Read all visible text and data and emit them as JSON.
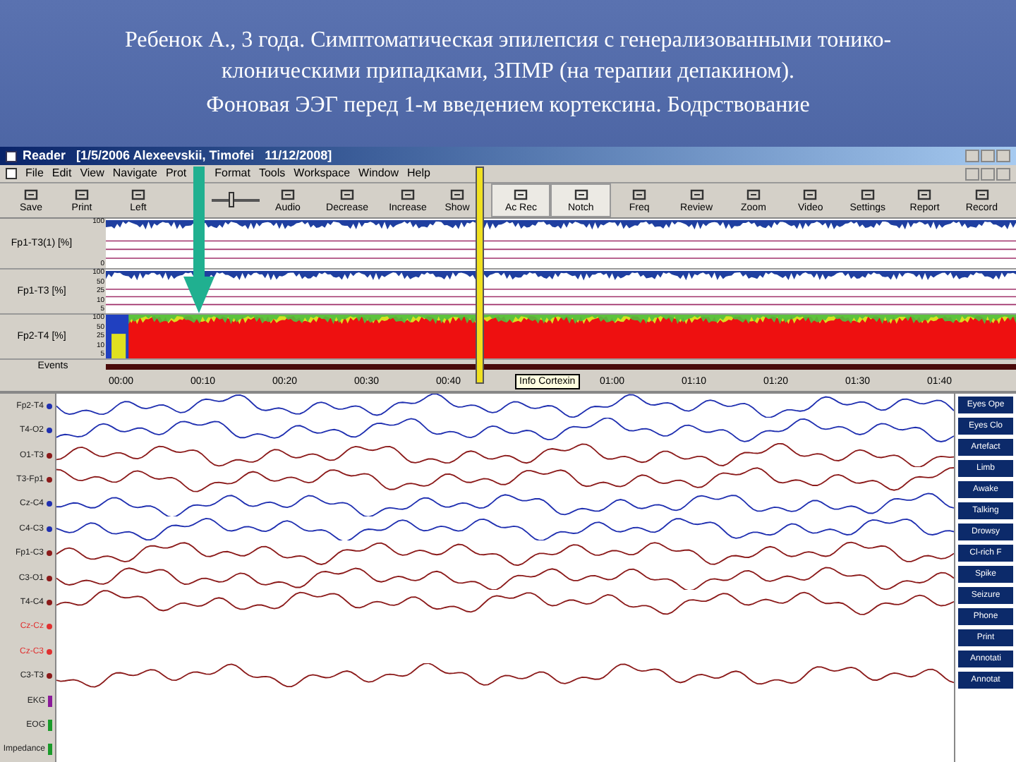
{
  "slide": {
    "title_lines": [
      "Ребенок А., 3 года. Симптоматическая эпилепсия с генерализованными тонико-клоническими припадками, ЗПМР (на терапии депакином).",
      "Фоновая ЭЭГ перед 1-м введением кортексина. Бодрствование"
    ]
  },
  "window": {
    "title": "Reader   [1/5/2006 Alexeevskii, Timofei   11/12/2008]"
  },
  "menu": [
    "File",
    "Edit",
    "View",
    "Navigate",
    "Prot",
    "Format",
    "Tools",
    "Workspace",
    "Window",
    "Help"
  ],
  "toolbar": [
    {
      "kind": "button",
      "label": "Save",
      "selected": false
    },
    {
      "kind": "button",
      "label": "Print",
      "selected": false
    },
    {
      "kind": "button",
      "label": "Left",
      "selected": false
    },
    {
      "kind": "slider",
      "level": 0.35
    },
    {
      "kind": "button",
      "label": "Audio",
      "selected": false
    },
    {
      "kind": "button",
      "label": "Decrease",
      "selected": false
    },
    {
      "kind": "button",
      "label": "Increase",
      "selected": false
    },
    {
      "kind": "button",
      "label": "Show",
      "selected": false
    },
    {
      "kind": "button",
      "label": "Ac Rec",
      "selected": true
    },
    {
      "kind": "button",
      "label": "Notch",
      "selected": true
    },
    {
      "kind": "button",
      "label": "Freq",
      "selected": false
    },
    {
      "kind": "button",
      "label": "Review",
      "selected": false
    },
    {
      "kind": "button",
      "label": "Zoom",
      "selected": false
    },
    {
      "kind": "button",
      "label": "Video",
      "selected": false
    },
    {
      "kind": "button",
      "label": "Settings",
      "selected": false
    },
    {
      "kind": "button",
      "label": "Report",
      "selected": false
    },
    {
      "kind": "button",
      "label": "Record",
      "selected": false
    }
  ],
  "trend": {
    "rows": [
      {
        "kind": "line",
        "label": "Fp1-T3(1) [%]",
        "yticks": [
          "100",
          "0"
        ]
      },
      {
        "kind": "line",
        "label": "Fp1-T3 [%]",
        "yticks": [
          "100",
          "50",
          "25",
          "10",
          "5"
        ]
      },
      {
        "kind": "spectrum",
        "label": "Fp2-T4 [%]",
        "yticks": [
          "100",
          "50",
          "25",
          "10",
          "5"
        ]
      }
    ],
    "events_label": "Events",
    "time_axis": [
      {
        "kind": "tick",
        "label": "00:00"
      },
      {
        "kind": "tick",
        "label": "00:10"
      },
      {
        "kind": "tick",
        "label": "00:20"
      },
      {
        "kind": "tick",
        "label": "00:30"
      },
      {
        "kind": "tick",
        "label": "00:40"
      },
      {
        "kind": "tooltip",
        "label": "Info Cortexin"
      },
      {
        "kind": "tick",
        "label": "01:00"
      },
      {
        "kind": "tick",
        "label": "01:10"
      },
      {
        "kind": "tick",
        "label": "01:20"
      },
      {
        "kind": "tick",
        "label": "01:30"
      },
      {
        "kind": "tick",
        "label": "01:40"
      }
    ]
  },
  "eeg": {
    "channels": [
      {
        "kind": "trace",
        "label": "Fp2-T4",
        "color": "#1f2fb0"
      },
      {
        "kind": "trace",
        "label": "T4-O2",
        "color": "#1f2fb0"
      },
      {
        "kind": "trace",
        "label": "O1-T3",
        "color": "#8b1a1a"
      },
      {
        "kind": "trace",
        "label": "T3-Fp1",
        "color": "#8b1a1a"
      },
      {
        "kind": "trace",
        "label": "Cz-C4",
        "color": "#1f2fb0"
      },
      {
        "kind": "trace",
        "label": "C4-C3",
        "color": "#1f2fb0"
      },
      {
        "kind": "trace",
        "label": "Fp1-C3",
        "color": "#8b1a1a"
      },
      {
        "kind": "trace",
        "label": "C3-O1",
        "color": "#8b1a1a"
      },
      {
        "kind": "trace",
        "label": "T4-C4",
        "color": "#8b1a1a"
      },
      {
        "kind": "blank",
        "label": "Cz-Cz",
        "color": "#e03030"
      },
      {
        "kind": "blank",
        "label": "Cz-C3",
        "color": "#e03030"
      },
      {
        "kind": "trace",
        "label": "C3-T3",
        "color": "#8b1a1a"
      },
      {
        "kind": "meter",
        "label": "EKG",
        "color": "#8a1a9a"
      },
      {
        "kind": "meter",
        "label": "EOG",
        "color": "#1a9a2a"
      },
      {
        "kind": "meter",
        "label": "Impedance",
        "color": "#1a9a2a"
      }
    ],
    "side_buttons": [
      "Eyes Ope",
      "Eyes Clo",
      "Artefact",
      "Limb",
      "Awake",
      "Talking",
      "Drowsy",
      "Cl-rich F",
      "Spike",
      "Seizure",
      "Phone",
      "Print",
      "Annotati",
      "Annotat"
    ]
  }
}
